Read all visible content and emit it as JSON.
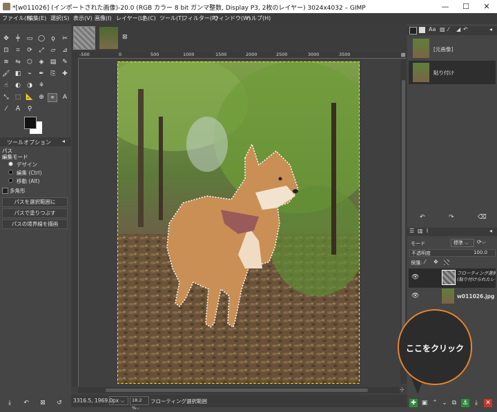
{
  "window": {
    "title": "*[w011026] (インポートされた画像)-20.0 (RGB カラー 8 bit ガンマ整数, Display P3, 2枚のレイヤー) 3024x4032 – GIMP",
    "minimize": "—",
    "maximize": "☐",
    "close": "✕"
  },
  "menubar": [
    "ファイル(F)",
    "編集(E)",
    "選択(S)",
    "表示(V)",
    "画像(I)",
    "レイヤー(L)",
    "色(C)",
    "ツール(T)",
    "フィルター(R)",
    "ウィンドウ(W)",
    "ヘルプ(H)"
  ],
  "tool_options": {
    "tab_label": "ツールオプション",
    "tool_name": "パス",
    "edit_mode_label": "編集モード",
    "modes": [
      "デザイン",
      "編集 (Ctrl)",
      "移動 (Alt)"
    ],
    "polygon_label": "多角形",
    "buttons": [
      "パスを選択範囲に",
      "パスで塗りつぶす",
      "パスの境界線を描画"
    ]
  },
  "ruler": {
    "labels": [
      "-500",
      "0",
      "500",
      "1000",
      "1500",
      "2000",
      "2500",
      "3000",
      "3500"
    ]
  },
  "status": {
    "coords": "3316.5, 1969.0",
    "unit": "px",
    "zoom": "18.2 %",
    "message": "フローティング選択範囲"
  },
  "channels_panel": {
    "items": [
      {
        "label": "[元画像]"
      },
      {
        "label": "貼り付け"
      }
    ]
  },
  "layers_panel": {
    "mode_label": "モード",
    "mode_value": "標準",
    "opacity_label": "不透明度",
    "opacity_value": "100.0",
    "lock_label": "保護:",
    "layers": [
      {
        "name": "フローティング選択範囲\n(貼り付けられたレイヤー)"
      },
      {
        "name": "w011026.jpg"
      }
    ]
  },
  "annotation": {
    "text": "ここをクリック",
    "accent": "#e8842c"
  }
}
